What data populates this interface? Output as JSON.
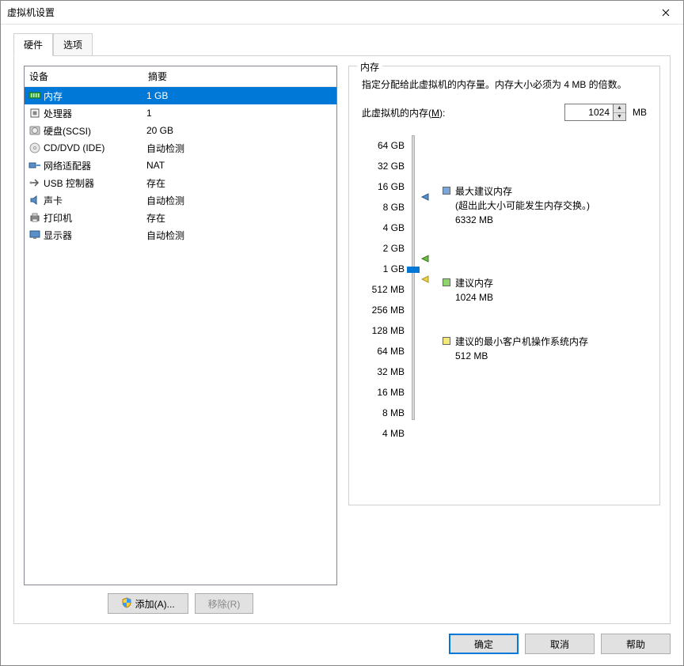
{
  "window": {
    "title": "虚拟机设置"
  },
  "tabs": {
    "hardware": "硬件",
    "options": "选项"
  },
  "device_list": {
    "header_device": "设备",
    "header_summary": "摘要",
    "rows": [
      {
        "name": "内存",
        "summary": "1 GB",
        "icon": "memory"
      },
      {
        "name": "处理器",
        "summary": "1",
        "icon": "cpu"
      },
      {
        "name": "硬盘(SCSI)",
        "summary": "20 GB",
        "icon": "hdd"
      },
      {
        "name": "CD/DVD (IDE)",
        "summary": "自动检测",
        "icon": "cd"
      },
      {
        "name": "网络适配器",
        "summary": "NAT",
        "icon": "nic"
      },
      {
        "name": "USB 控制器",
        "summary": "存在",
        "icon": "usb"
      },
      {
        "name": "声卡",
        "summary": "自动检测",
        "icon": "sound"
      },
      {
        "name": "打印机",
        "summary": "存在",
        "icon": "printer"
      },
      {
        "name": "显示器",
        "summary": "自动检测",
        "icon": "display"
      }
    ]
  },
  "buttons": {
    "add": "添加(A)...",
    "remove": "移除(R)",
    "ok": "确定",
    "cancel": "取消",
    "help": "帮助"
  },
  "memory_panel": {
    "title": "内存",
    "desc": "指定分配给此虚拟机的内存量。内存大小必须为 4 MB 的倍数。",
    "input_label_pre": "此虚拟机的内存(",
    "input_label_hotkey": "M",
    "input_label_post": "):",
    "value": "1024",
    "unit": "MB",
    "ticks": [
      "64 GB",
      "32 GB",
      "16 GB",
      "8 GB",
      "4 GB",
      "2 GB",
      "1 GB",
      "512 MB",
      "256 MB",
      "128 MB",
      "64 MB",
      "32 MB",
      "16 MB",
      "8 MB",
      "4 MB"
    ],
    "legend_max_title": "最大建议内存",
    "legend_max_note": "(超出此大小可能发生内存交换。)",
    "legend_max_value": "6332 MB",
    "legend_rec_title": "建议内存",
    "legend_rec_value": "1024 MB",
    "legend_min_title": "建议的最小客户机操作系统内存",
    "legend_min_value": "512 MB"
  }
}
